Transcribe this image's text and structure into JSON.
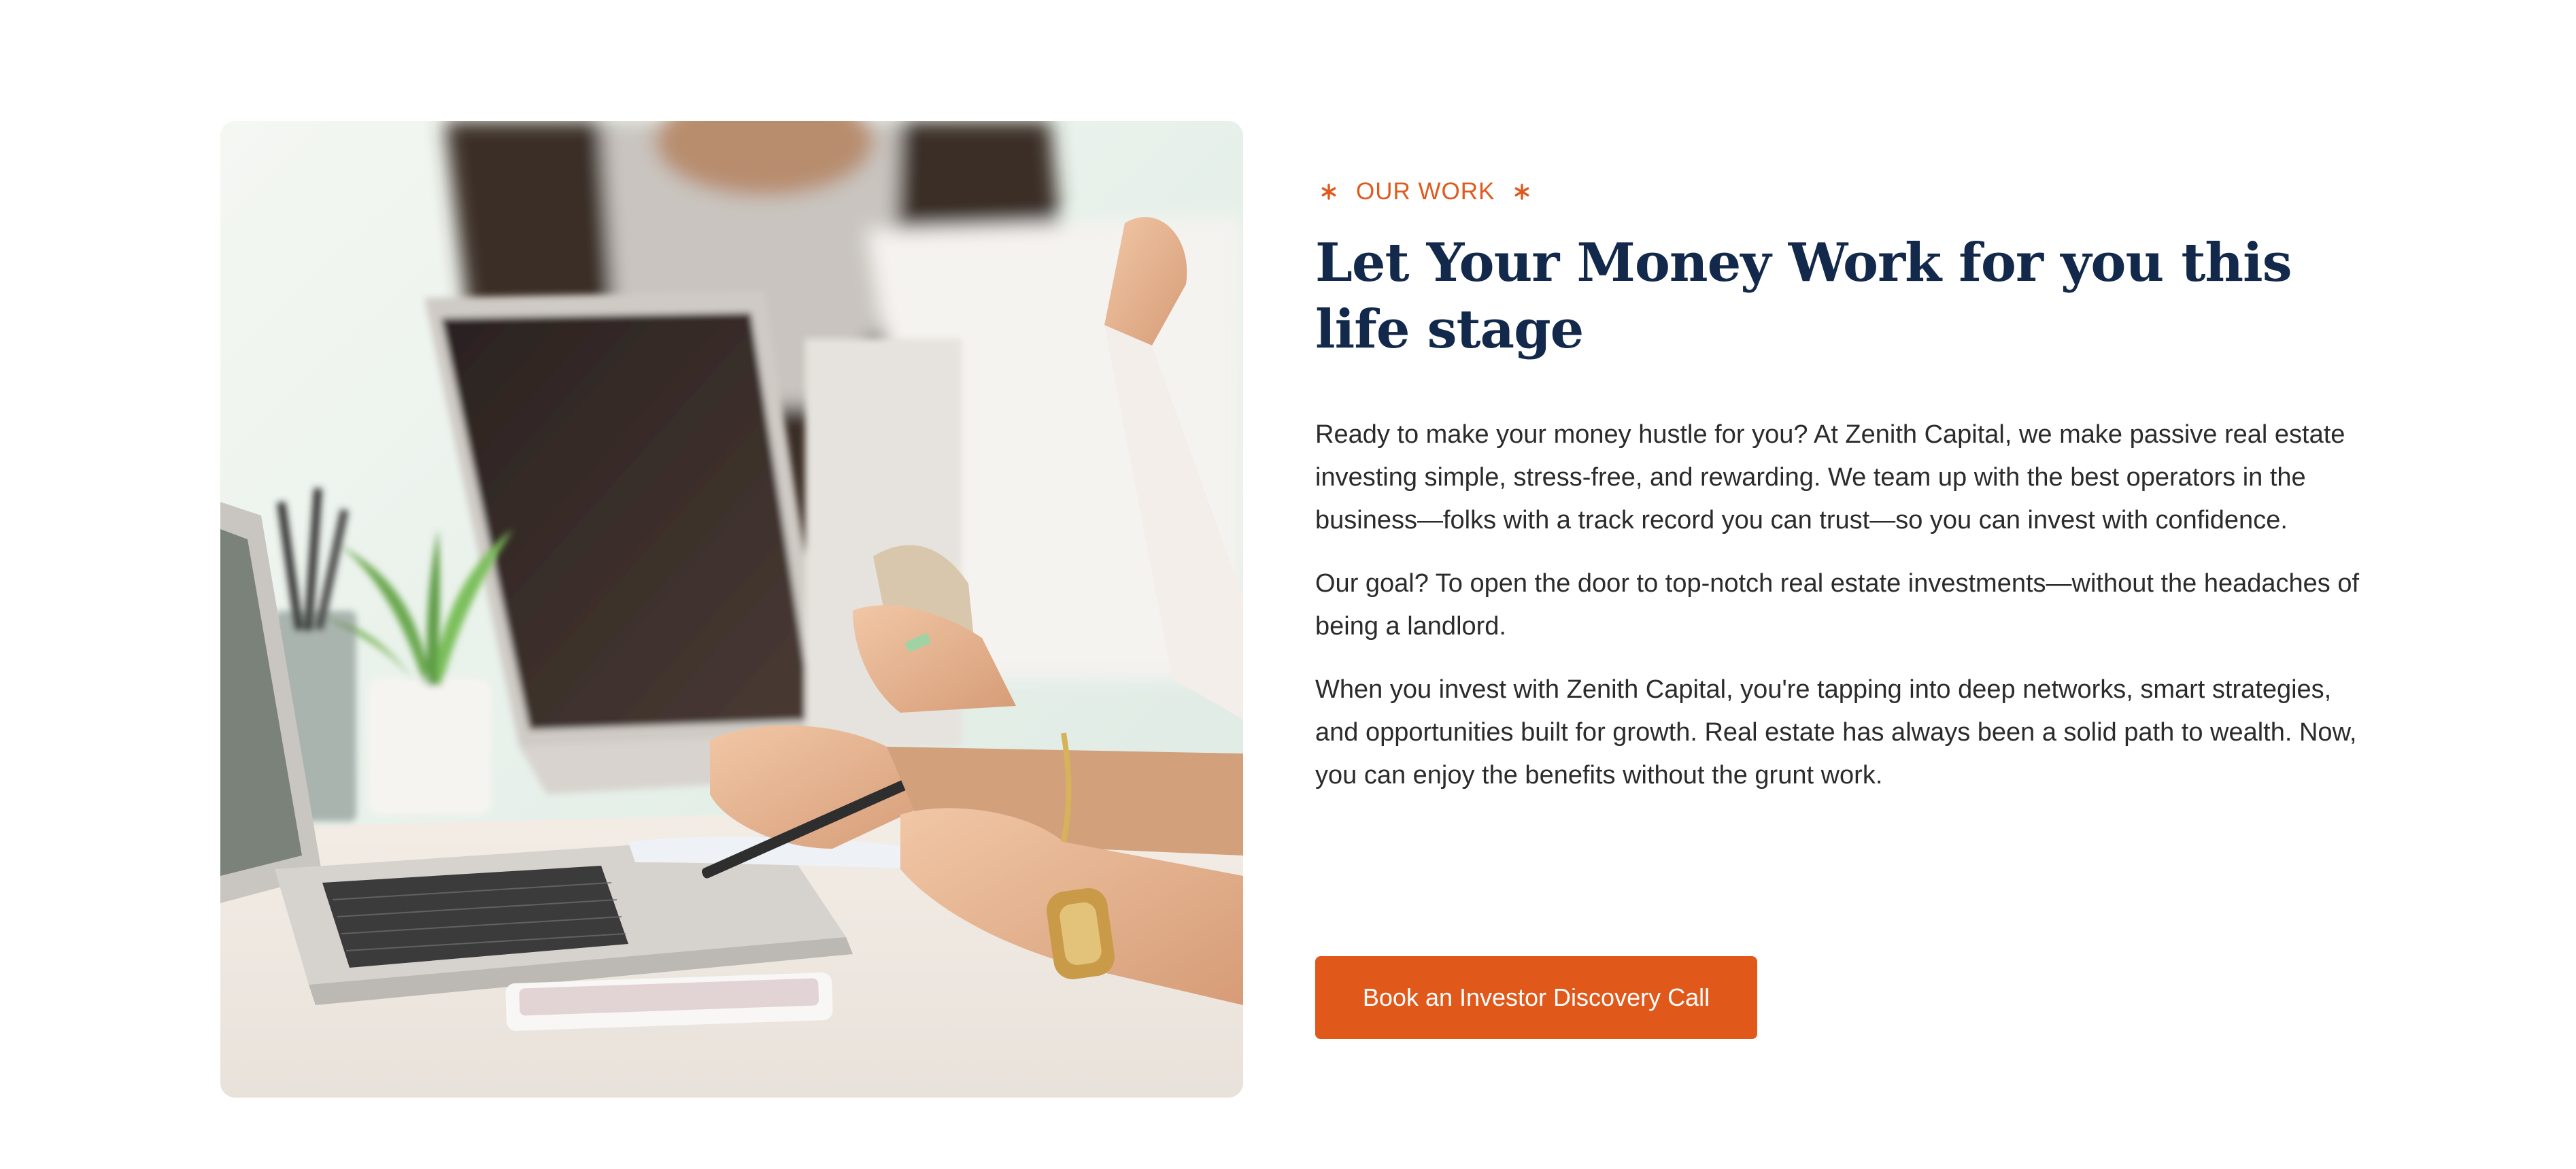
{
  "section": {
    "eyebrow": "OUR WORK",
    "headline": "Let Your Money Work for you this life stage",
    "paragraphs": [
      "Ready to make your money hustle for you? At Zenith Capital, we make passive real estate investing simple, stress-free, and rewarding. We team up with the best operators in the business—folks with a track record you can trust—so you can invest with confidence.",
      "Our goal? To open the door to top-notch real estate investments—without the headaches of being a landlord.",
      "When you invest with Zenith Capital, you're tapping into deep networks, smart strategies, and opportunities built for growth. Real estate has always been a solid path to wealth. Now, you can enjoy the benefits without the grunt work."
    ],
    "cta_label": "Book an Investor Discovery Call"
  },
  "icons": {
    "eyebrow_left": "asterisk-star-icon",
    "eyebrow_right": "asterisk-star-icon"
  },
  "colors": {
    "accent": "#e0581a",
    "headline": "#13294b",
    "body_text": "#2b2b2b",
    "background": "#ffffff"
  }
}
